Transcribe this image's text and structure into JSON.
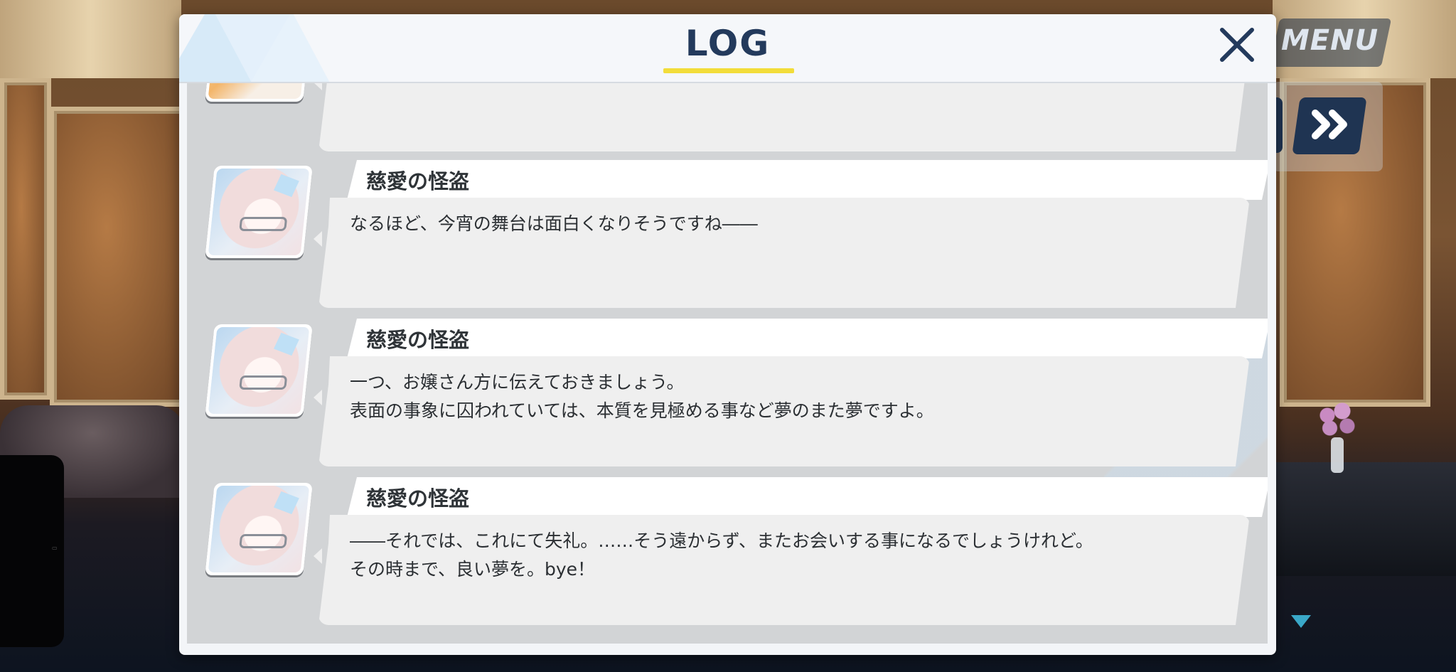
{
  "window": {
    "title": "LOG"
  },
  "hud": {
    "menu_label": "MENU"
  },
  "log_entries": [
    {
      "speaker": "",
      "lines": [
        "（…………）",
        ""
      ]
    },
    {
      "speaker": "慈愛の怪盗",
      "lines": [
        "なるほど、今宵の舞台は面白くなりそうですね――",
        ""
      ]
    },
    {
      "speaker": "慈愛の怪盗",
      "lines": [
        "一つ、お嬢さん方に伝えておきましょう。",
        "表面の事象に囚われていては、本質を見極める事など夢のまた夢ですよ。"
      ]
    },
    {
      "speaker": "慈愛の怪盗",
      "lines": [
        "――それでは、これにて失礼。……そう遠からず、またお会いする事になるでしょうけれど。",
        "その時まで、良い夢を。bye！"
      ]
    }
  ],
  "colors": {
    "title": "#233a5c",
    "accent_underline": "#f2dd3a",
    "hud_button": "#1f3452",
    "scroll_arrow": "#3aa8c8"
  },
  "icons": {
    "close": "close-icon",
    "skip": "fast-forward-icon",
    "scroll": "triangle-down-icon"
  }
}
